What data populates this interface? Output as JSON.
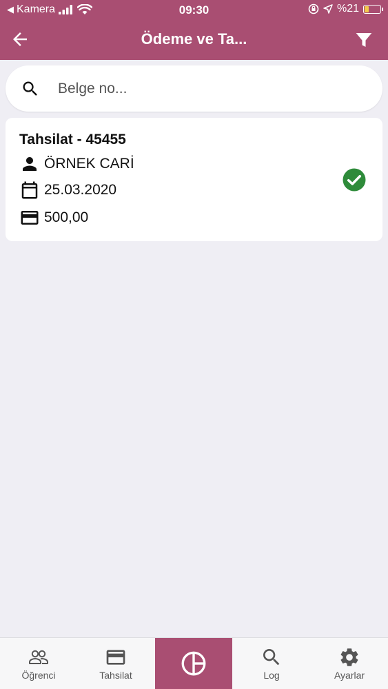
{
  "status_bar": {
    "carrier": "Kamera",
    "time": "09:30",
    "battery": "%21"
  },
  "header": {
    "title": "Ödeme ve Ta..."
  },
  "search": {
    "placeholder": "Belge no..."
  },
  "records": [
    {
      "title": "Tahsilat - 45455",
      "customer": "ÖRNEK CARİ",
      "date": "25.03.2020",
      "amount": "500,00",
      "status_icon": "check-circle-icon"
    }
  ],
  "tabs": [
    {
      "label": "Öğrenci",
      "icon": "people-icon"
    },
    {
      "label": "Tahsilat",
      "icon": "credit-card-icon"
    },
    {
      "label": "",
      "icon": "pie-chart-icon"
    },
    {
      "label": "Log",
      "icon": "search-icon"
    },
    {
      "label": "Ayarlar",
      "icon": "gear-icon"
    }
  ],
  "colors": {
    "primary": "#a94e72",
    "background": "#efeef4",
    "success": "#2e8b3a"
  }
}
